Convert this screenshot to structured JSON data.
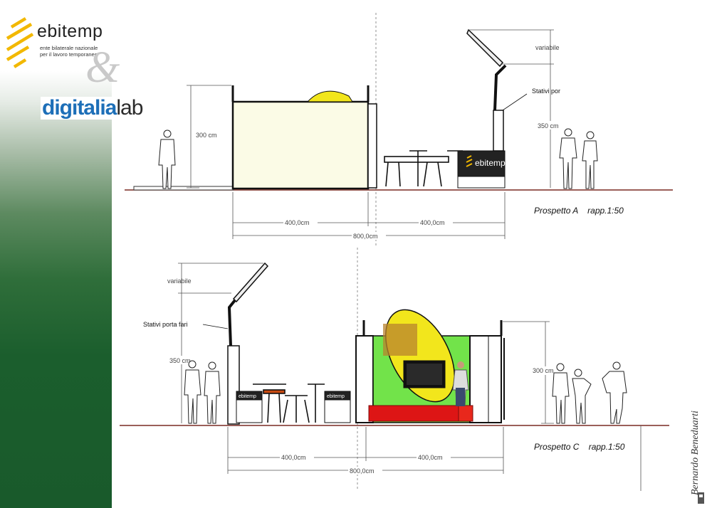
{
  "branding": {
    "name": "ebitemp",
    "subtitle_line1": "ente bilaterale nazionale",
    "subtitle_line2": "per il lavoro temporaneo",
    "ampersand": "&",
    "partner_main": "digitalia",
    "partner_suffix": "lab"
  },
  "elevation_a": {
    "caption": "Prospetto A    rapp.1:50",
    "height_left": "300 cm",
    "height_right": "350 cm",
    "variable_label": "variabile",
    "stand_label": "Stativi por",
    "dim_left": "400,0cm",
    "dim_right": "400,0cm",
    "dim_total": "800,0cm",
    "sign_text": "ebitemp"
  },
  "elevation_c": {
    "caption": "Prospetto C    rapp.1:50",
    "height_left": "350 cm",
    "height_right": "300 cm",
    "variable_label": "variabile",
    "stand_label": "Stativi porta fari",
    "dim_left": "400,0cm",
    "dim_right": "400,0cm",
    "dim_total": "800,0cm",
    "counter_label": "ebitemp"
  },
  "signature": "Bernardo Beneduarti",
  "colors": {
    "sidebar_green": "#1b5e2d",
    "floor_line": "#7a2a22",
    "panel_cream": "#fbfbe6",
    "yellow": "#f2e61c",
    "lime": "#72e34a",
    "red": "#dd1515",
    "accent_gold": "#f2b800",
    "partner_blue": "#1d6fb8"
  }
}
